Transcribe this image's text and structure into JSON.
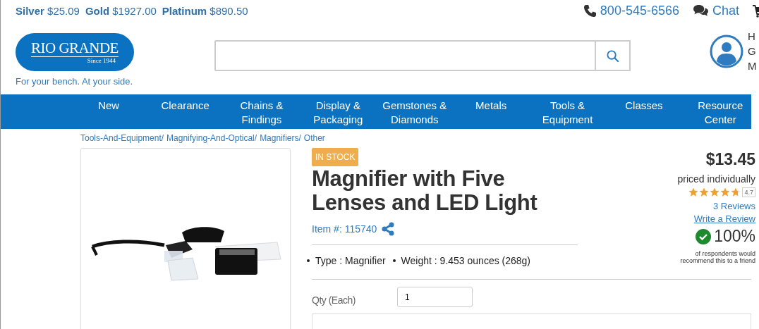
{
  "metal_prices": [
    {
      "metal": "Silver",
      "price": "$25.09"
    },
    {
      "metal": "Gold",
      "price": "$1927.00"
    },
    {
      "metal": "Platinum",
      "price": "$890.50"
    }
  ],
  "contact": {
    "phone": "800-545-6566",
    "chat": "Chat"
  },
  "logo": {
    "name": "RIO GRANDE",
    "since": "Since 1944",
    "tagline": "For your bench. At your side."
  },
  "account_lines": [
    "H",
    "G",
    "M"
  ],
  "nav": [
    {
      "label": "New"
    },
    {
      "label": "Clearance"
    },
    {
      "label": "Chains &\nFindings"
    },
    {
      "label": "Display &\nPackaging"
    },
    {
      "label": "Gemstones &\nDiamonds"
    },
    {
      "label": "Metals"
    },
    {
      "label": "Tools &\nEquipment"
    },
    {
      "label": "Classes"
    },
    {
      "label": "Resource\nCenter"
    }
  ],
  "breadcrumb": [
    "Tools-And-Equipment/",
    "Magnifying-And-Optical/",
    "Magnifiers/",
    "Other"
  ],
  "product": {
    "stock_badge": "IN STOCK",
    "title": "Magnifier with Five Lenses and LED Light",
    "item_number": "Item #: 115740",
    "specs": [
      "Type : Magnifier",
      "Weight : 9.453 ounces (268g)"
    ],
    "qty_label": "Qty (Each)",
    "qty_value": "1"
  },
  "pricing": {
    "price": "$13.45",
    "price_note": "priced individually",
    "stars": 4.7,
    "rating": "4.7",
    "reviews": "3 Reviews",
    "write_review": "Write a Review",
    "recommend_percent": "100%",
    "recommend_note": "of respondents would recommend this to a friend"
  }
}
